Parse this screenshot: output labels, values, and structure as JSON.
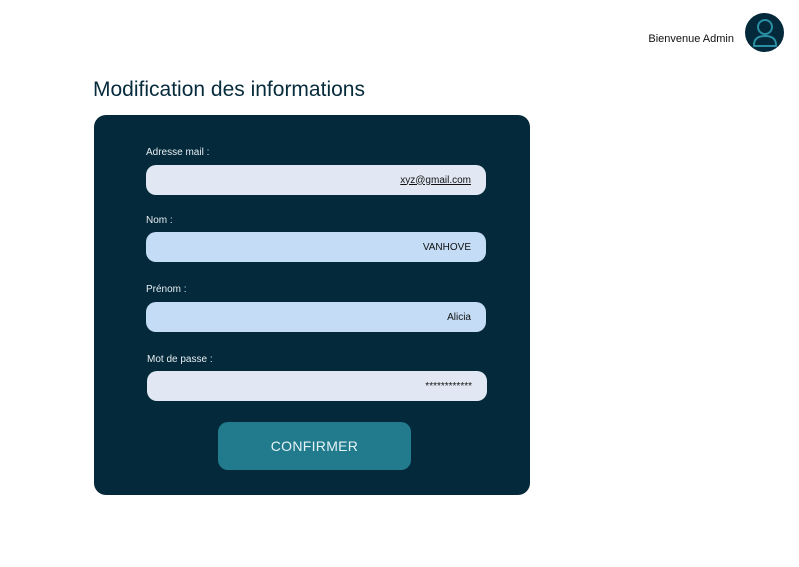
{
  "header": {
    "greeting": "Bienvenue Admin",
    "avatar_icon": "user-icon"
  },
  "page": {
    "title": "Modification des informations"
  },
  "form": {
    "email": {
      "label": "Adresse mail :",
      "value": "xyz@gmail.com"
    },
    "last_name": {
      "label": "Nom :",
      "value": "VANHOVE"
    },
    "first_name": {
      "label": "Prénom :",
      "value": "Alicia"
    },
    "password": {
      "label": "Mot de passe :",
      "value": "************"
    },
    "confirm_label": "CONFIRMER"
  },
  "colors": {
    "card_background": "#03293a",
    "button_background": "#217b8d",
    "input_light": "#e1e8f3",
    "input_blue": "#c4dcf5"
  }
}
